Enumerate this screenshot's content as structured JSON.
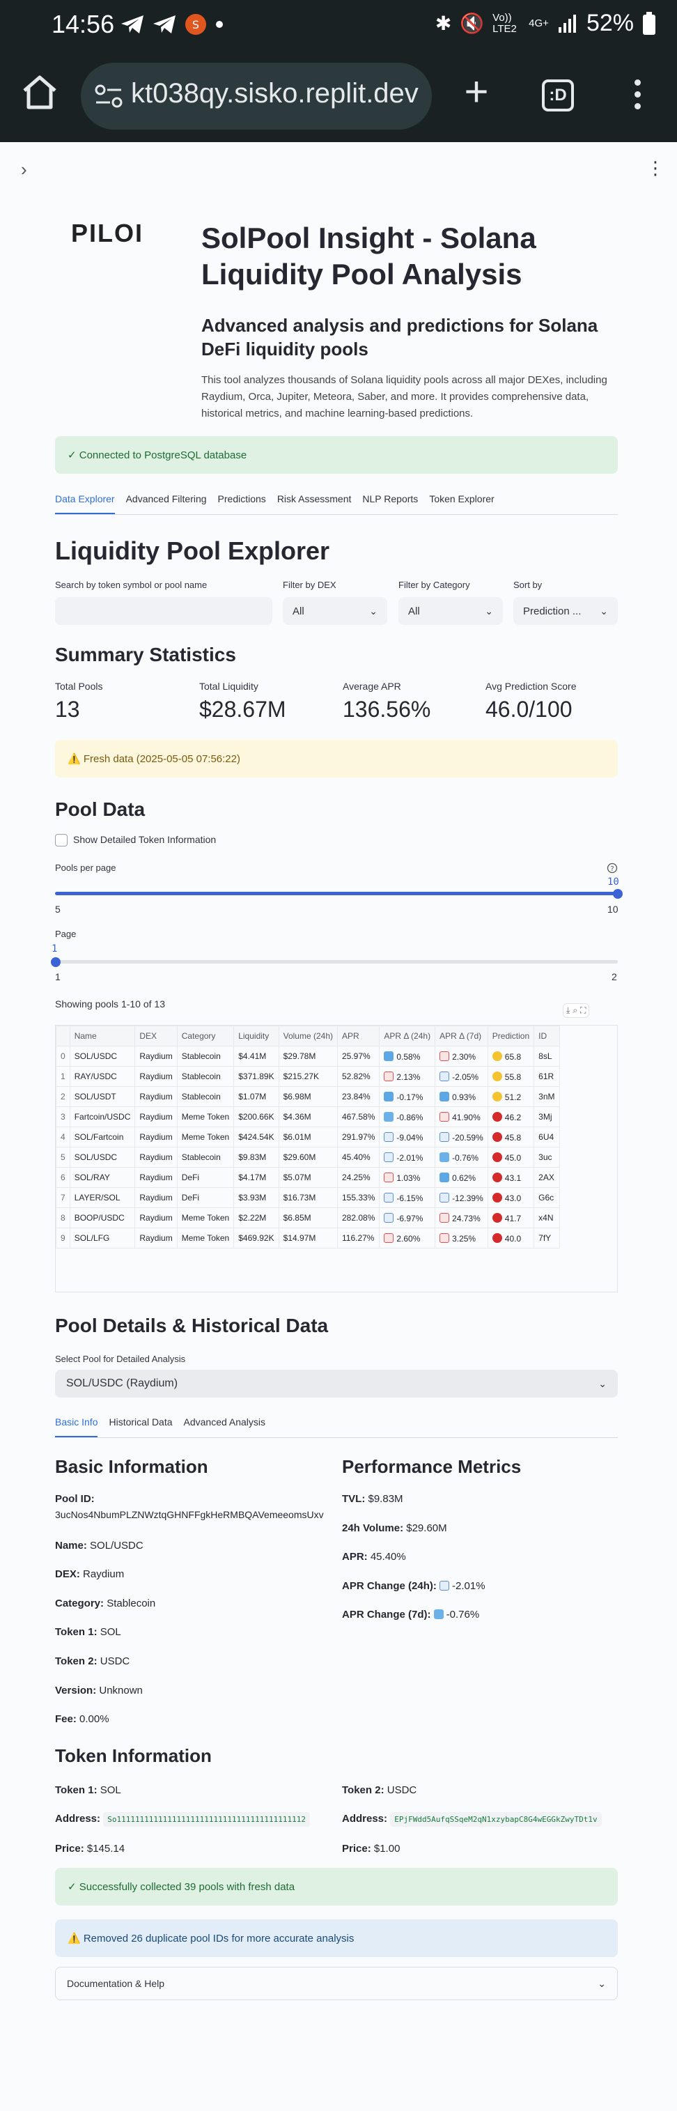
{
  "status_bar": {
    "time": "14:56",
    "net_label": "Vo)) LTE2",
    "net_label2": "4G+",
    "battery": "52%"
  },
  "browser": {
    "url": "kt038qy.sisko.replit.dev",
    "tabs_label": ":D"
  },
  "app": {
    "logo_text": "PILOI",
    "title": "SolPool Insight - Solana Liquidity Pool Analysis",
    "subtitle": "Advanced analysis and predictions for Solana DeFi liquidity pools",
    "description": "This tool analyzes thousands of Solana liquidity pools across all major DEXes, including Raydium, Orca, Jupiter, Meteora, Saber, and more. It provides comprehensive data, historical metrics, and machine learning-based predictions.",
    "db_status": "✓ Connected to PostgreSQL database"
  },
  "main_tabs": [
    "Data Explorer",
    "Advanced Filtering",
    "Predictions",
    "Risk Assessment",
    "NLP Reports",
    "Token Explorer"
  ],
  "explorer": {
    "title": "Liquidity Pool Explorer",
    "search_label": "Search by token symbol or pool name",
    "search_placeholder": "",
    "dex_label": "Filter by DEX",
    "dex_value": "All",
    "category_label": "Filter by Category",
    "category_value": "All",
    "sort_label": "Sort by",
    "sort_value": "Prediction ..."
  },
  "summary": {
    "title": "Summary Statistics",
    "metrics": [
      {
        "label": "Total Pools",
        "value": "13"
      },
      {
        "label": "Total Liquidity",
        "value": "$28.67M"
      },
      {
        "label": "Average APR",
        "value": "136.56%"
      },
      {
        "label": "Avg Prediction Score",
        "value": "46.0/100"
      }
    ],
    "fresh_notice": "⚠️ Fresh data (2025-05-05 07:56:22)"
  },
  "pool_data": {
    "title": "Pool Data",
    "checkbox_label": "Show Detailed Token Information",
    "per_page_label": "Pools per page",
    "per_page_min": "5",
    "per_page_max": "10",
    "per_page_value": "10",
    "page_label": "Page",
    "page_min": "1",
    "page_max": "2",
    "page_value": "1",
    "showing": "Showing pools 1-10 of 13",
    "columns": [
      "",
      "Name",
      "DEX",
      "Category",
      "Liquidity",
      "Volume (24h)",
      "APR",
      "APR Δ (24h)",
      "APR Δ (7d)",
      "Prediction",
      "ID"
    ],
    "rows": [
      {
        "idx": "0",
        "name": "SOL/USDC",
        "dex": "Raydium",
        "category": "Stablecoin",
        "liquidity": "$4.41M",
        "volume": "$29.78M",
        "apr": "25.97%",
        "d24": "0.58%",
        "d24i": "up",
        "d7": "2.30%",
        "d7i": "trend-up",
        "pred": "65.8",
        "predi": "yellow",
        "id": "8sL"
      },
      {
        "idx": "1",
        "name": "RAY/USDC",
        "dex": "Raydium",
        "category": "Stablecoin",
        "liquidity": "$371.89K",
        "volume": "$215.27K",
        "apr": "52.82%",
        "d24": "2.13%",
        "d24i": "trend-up",
        "d7": "-2.05%",
        "d7i": "trend-down",
        "pred": "55.8",
        "predi": "yellow",
        "id": "61R"
      },
      {
        "idx": "2",
        "name": "SOL/USDT",
        "dex": "Raydium",
        "category": "Stablecoin",
        "liquidity": "$1.07M",
        "volume": "$6.98M",
        "apr": "23.84%",
        "d24": "-0.17%",
        "d24i": "up",
        "d7": "0.93%",
        "d7i": "up",
        "pred": "51.2",
        "predi": "yellow",
        "id": "3nM"
      },
      {
        "idx": "3",
        "name": "Fartcoin/USDC",
        "dex": "Raydium",
        "category": "Meme Token",
        "liquidity": "$200.66K",
        "volume": "$4.36M",
        "apr": "467.58%",
        "d24": "-0.86%",
        "d24i": "down",
        "d7": "41.90%",
        "d7i": "trend-up",
        "pred": "46.2",
        "predi": "red",
        "id": "3Mj"
      },
      {
        "idx": "4",
        "name": "SOL/Fartcoin",
        "dex": "Raydium",
        "category": "Meme Token",
        "liquidity": "$424.54K",
        "volume": "$6.01M",
        "apr": "291.97%",
        "d24": "-9.04%",
        "d24i": "trend-down",
        "d7": "-20.59%",
        "d7i": "trend-down",
        "pred": "45.8",
        "predi": "red",
        "id": "6U4"
      },
      {
        "idx": "5",
        "name": "SOL/USDC",
        "dex": "Raydium",
        "category": "Stablecoin",
        "liquidity": "$9.83M",
        "volume": "$29.60M",
        "apr": "45.40%",
        "d24": "-2.01%",
        "d24i": "trend-down",
        "d7": "-0.76%",
        "d7i": "down",
        "pred": "45.0",
        "predi": "red",
        "id": "3uc"
      },
      {
        "idx": "6",
        "name": "SOL/RAY",
        "dex": "Raydium",
        "category": "DeFi",
        "liquidity": "$4.17M",
        "volume": "$5.07M",
        "apr": "24.25%",
        "d24": "1.03%",
        "d24i": "trend-up",
        "d7": "0.62%",
        "d7i": "up",
        "pred": "43.1",
        "predi": "red",
        "id": "2AX"
      },
      {
        "idx": "7",
        "name": "LAYER/SOL",
        "dex": "Raydium",
        "category": "DeFi",
        "liquidity": "$3.93M",
        "volume": "$16.73M",
        "apr": "155.33%",
        "d24": "-6.15%",
        "d24i": "trend-down",
        "d7": "-12.39%",
        "d7i": "trend-down",
        "pred": "43.0",
        "predi": "red",
        "id": "G6c"
      },
      {
        "idx": "8",
        "name": "BOOP/USDC",
        "dex": "Raydium",
        "category": "Meme Token",
        "liquidity": "$2.22M",
        "volume": "$6.85M",
        "apr": "282.08%",
        "d24": "-6.97%",
        "d24i": "trend-down",
        "d7": "24.73%",
        "d7i": "trend-up",
        "pred": "41.7",
        "predi": "red",
        "id": "x4N"
      },
      {
        "idx": "9",
        "name": "SOL/LFG",
        "dex": "Raydium",
        "category": "Meme Token",
        "liquidity": "$469.92K",
        "volume": "$14.97M",
        "apr": "116.27%",
        "d24": "2.60%",
        "d24i": "trend-up",
        "d7": "3.25%",
        "d7i": "trend-up",
        "pred": "40.0",
        "predi": "red",
        "id": "7fY"
      }
    ]
  },
  "details": {
    "title": "Pool Details & Historical Data",
    "select_label": "Select Pool for Detailed Analysis",
    "select_value": "SOL/USDC (Raydium)",
    "tabs": [
      "Basic Info",
      "Historical Data",
      "Advanced Analysis"
    ],
    "basic_title": "Basic Information",
    "pool_id_label": "Pool ID:",
    "pool_id": "3ucNos4NbumPLZNWztqGHNFFgkHeRMBQAVemeeomsUxv",
    "name_label": "Name:",
    "name": "SOL/USDC",
    "dex_label": "DEX:",
    "dex": "Raydium",
    "category_label": "Category:",
    "category": "Stablecoin",
    "token1_label": "Token 1:",
    "token1": "SOL",
    "token2_label": "Token 2:",
    "token2": "USDC",
    "version_label": "Version:",
    "version": "Unknown",
    "fee_label": "Fee:",
    "fee": "0.00%",
    "perf_title": "Performance Metrics",
    "tvl_label": "TVL:",
    "tvl": "$9.83M",
    "vol_label": "24h Volume:",
    "vol": "$29.60M",
    "apr_label": "APR:",
    "apr": "45.40%",
    "apr24_label": "APR Change (24h):",
    "apr24": "-2.01%",
    "apr7_label": "APR Change (7d):",
    "apr7": "-0.76%"
  },
  "token_info": {
    "title": "Token Information",
    "t1_label": "Token 1:",
    "t1": "SOL",
    "t1_addr_label": "Address:",
    "t1_addr": "So11111111111111111111111111111111111111112",
    "t1_price_label": "Price:",
    "t1_price": "$145.14",
    "t2_label": "Token 2:",
    "t2": "USDC",
    "t2_addr_label": "Address:",
    "t2_addr": "EPjFWdd5AufqSSqeM2qN1xzybapC8G4wEGGkZwyTDt1v",
    "t2_price_label": "Price:",
    "t2_price": "$1.00"
  },
  "notices": {
    "collected": "✓ Successfully collected 39 pools with fresh data",
    "removed": "⚠️ Removed 26 duplicate pool IDs for more accurate analysis"
  },
  "docs": {
    "label": "Documentation & Help"
  }
}
